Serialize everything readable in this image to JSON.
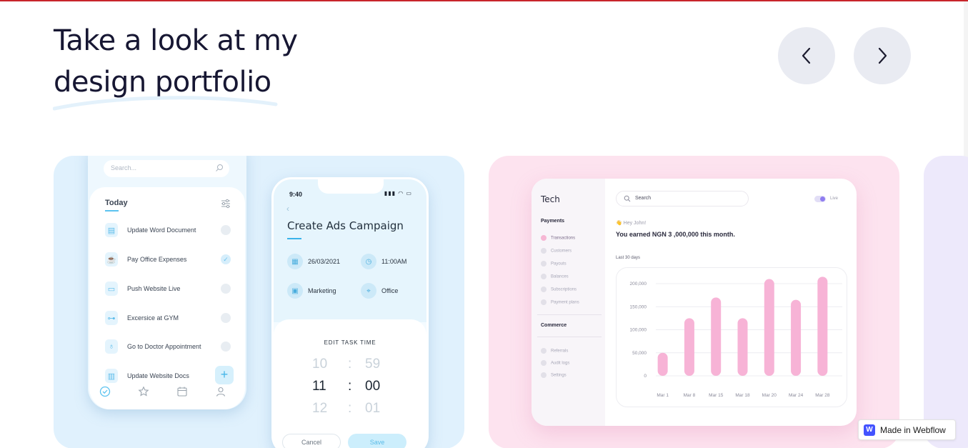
{
  "heading": {
    "line1": "Take a look at my",
    "line2": "design portfolio"
  },
  "nav": {
    "prev_icon": "chevron-left-icon",
    "next_icon": "chevron-right-icon"
  },
  "colors": {
    "accent_line": "#c8252b",
    "card1_bg": "#e0f1fd",
    "card2_bg": "#fde3ef",
    "card3_bg": "#ede9fb",
    "bar_color": "#f7b3d6",
    "webflow_blue": "#4353ff"
  },
  "todo_app": {
    "search_placeholder": "Search...",
    "section_title": "Today",
    "tasks": [
      {
        "label": "Update Word Document",
        "icon": "document-icon",
        "done": false
      },
      {
        "label": "Pay Office Expenses",
        "icon": "coffee-icon",
        "done": true
      },
      {
        "label": "Push Website Live",
        "icon": "laptop-icon",
        "done": false
      },
      {
        "label": "Excersice at GYM",
        "icon": "dumbbell-icon",
        "done": false
      },
      {
        "label": "Go to Doctor Appointment",
        "icon": "stethoscope-icon",
        "done": false
      },
      {
        "label": "Update Website Docs",
        "icon": "docs-icon",
        "done": false
      }
    ],
    "add_label": "+"
  },
  "task_app": {
    "time": "9:40",
    "status": "▮▮▮ ◠ ▭",
    "title": "Create Ads Campaign",
    "date": "26/03/2021",
    "clock": "11:00AM",
    "category": "Marketing",
    "place": "Office",
    "sheet_title": "EDIT TASK TIME",
    "time_rows": [
      {
        "h": "10",
        "m": "59"
      },
      {
        "h": "11",
        "m": "00"
      },
      {
        "h": "12",
        "m": "01"
      }
    ],
    "separator": ":",
    "cancel_label": "Cancel",
    "save_label": "Save"
  },
  "dashboard": {
    "logo": "Tech",
    "payments_section": "Payments",
    "payments_items": [
      "Transactions",
      "Customers",
      "Payouts",
      "Balances",
      "Subscriptions",
      "Payment plans"
    ],
    "commerce_section": "Commerce",
    "commerce_items": [
      "Referrals",
      "Audit logs",
      "Settings"
    ],
    "search_placeholder": "Search",
    "live_label": "Live",
    "greeting": "👋 Hey John!",
    "earned": "You earned NGN 3 ,000,000 this month.",
    "period": "Last 30 days"
  },
  "chart_data": {
    "type": "bar",
    "categories": [
      "Mar 1",
      "Mar 8",
      "Mar 15",
      "Mar 18",
      "Mar 20",
      "Mar 24",
      "Mar 28"
    ],
    "values": [
      50000,
      125000,
      170000,
      125000,
      210000,
      165000,
      215000
    ],
    "yticks": [
      "200,000",
      "150,000",
      "100,000",
      "50,000",
      "0"
    ],
    "ylim": [
      0,
      200000
    ],
    "grid": true
  },
  "webflow_badge": {
    "label": "Made in Webflow",
    "logo": "W"
  }
}
